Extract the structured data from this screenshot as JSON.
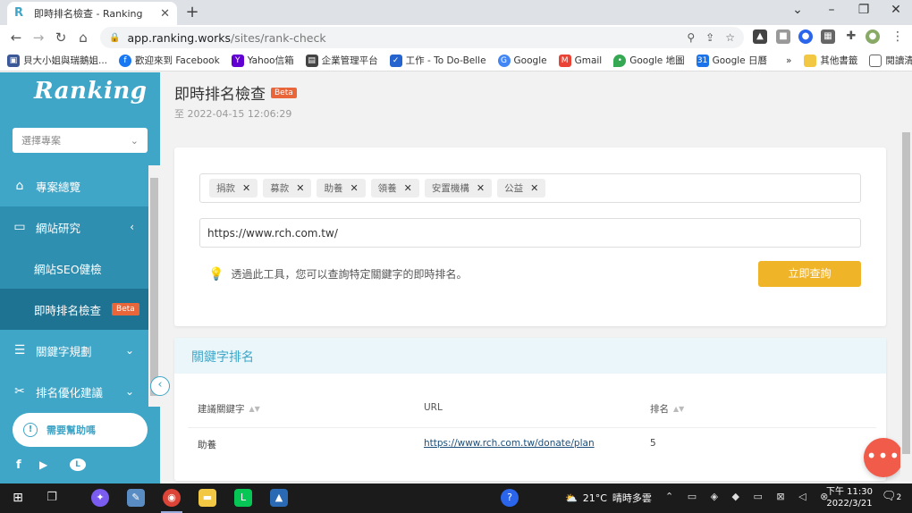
{
  "browser": {
    "tab_title": "即時排名檢查 - Ranking",
    "tab_favicon": "R",
    "url_host": "app.ranking.works",
    "url_path": "/sites/rank-check"
  },
  "bookmarks": [
    {
      "label": "貝大小姐與瑞鵝姐...",
      "icon": "photo-icon",
      "color": "#3b5998"
    },
    {
      "label": "歡迎來到 Facebook",
      "icon": "facebook-icon",
      "color": "#1877f2"
    },
    {
      "label": "Yahoo信箱",
      "icon": "yahoo-icon",
      "color": "#6001d2"
    },
    {
      "label": "企業管理平台",
      "icon": "platform-icon",
      "color": "#444444"
    },
    {
      "label": "工作 - To Do-Belle",
      "icon": "todo-icon",
      "color": "#2564cf"
    },
    {
      "label": "Google",
      "icon": "google-icon",
      "color": "#4285f4"
    },
    {
      "label": "Gmail",
      "icon": "gmail-icon",
      "color": "#ea4335"
    },
    {
      "label": "Google 地圖",
      "icon": "maps-icon",
      "color": "#34a853"
    },
    {
      "label": "Google 日曆",
      "icon": "calendar-icon",
      "color": "#1a73e8"
    }
  ],
  "bookmarks_more": "»",
  "bookmarks_other": "其他書籤",
  "bookmarks_reading": "閱讀清單",
  "sidebar": {
    "logo": "Ranking",
    "project_placeholder": "選擇專案",
    "menu": {
      "overview": "專案總覽",
      "site_research": "網站研究",
      "seo_check": "網站SEO健檢",
      "rank_check": "即時排名檢查",
      "rank_check_badge": "Beta",
      "keyword_plan": "關鍵字規劃",
      "rank_suggest": "排名優化建議"
    },
    "help": "需要幫助嗎"
  },
  "main": {
    "title": "即時排名檢查",
    "title_badge": "Beta",
    "timestamp": "至 2022-04-15 12:06:29",
    "keywords": [
      "捐款",
      "募款",
      "助養",
      "領養",
      "安置機構",
      "公益"
    ],
    "url_value": "https://www.rch.com.tw/",
    "hint": "透過此工具，您可以查詢特定關鍵字的即時排名。",
    "search_button": "立即查詢",
    "results": {
      "title": "關鍵字排名",
      "headers": {
        "keyword": "建議關鍵字",
        "url": "URL",
        "rank": "排名"
      },
      "rows": [
        {
          "keyword": "助養",
          "url": "https://www.rch.com.tw/donate/plan",
          "rank": "5"
        }
      ]
    }
  },
  "taskbar": {
    "weather_temp": "21°C",
    "weather_desc": "晴時多雲",
    "time": "下午 11:30",
    "date": "2022/3/21",
    "notifications": "2"
  },
  "colors": {
    "sidebar": "#3fa6c8",
    "accent_button": "#f0b429",
    "badge": "#e8663a",
    "fab": "#f05b4a"
  }
}
